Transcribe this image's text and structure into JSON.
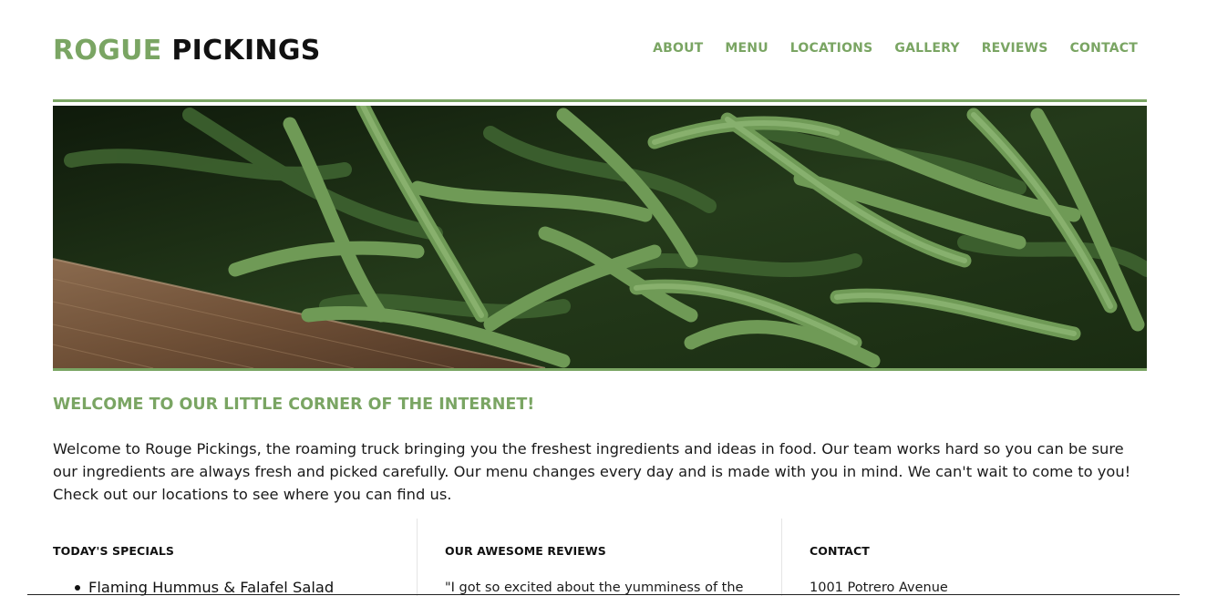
{
  "brand": {
    "accent_word": "ROGUE",
    "main_word": "PICKINGS"
  },
  "nav": {
    "items": [
      {
        "label": "ABOUT"
      },
      {
        "label": "MENU"
      },
      {
        "label": "LOCATIONS"
      },
      {
        "label": "GALLERY"
      },
      {
        "label": "REVIEWS"
      },
      {
        "label": "CONTACT"
      }
    ]
  },
  "welcome": {
    "title": "WELCOME TO OUR LITTLE CORNER OF THE INTERNET!",
    "body": "Welcome to Rouge Pickings, the roaming truck bringing you the freshest ingredients and ideas in food. Our team works hard so you can be sure our ingredients are always fresh and picked carefully. Our menu changes every day and is made with you in mind. We can't wait to come to you! Check out our locations to see where you can find us."
  },
  "specials": {
    "heading": "TODAY'S SPECIALS",
    "items": [
      "Flaming Hummus & Falafel Salad"
    ]
  },
  "reviews": {
    "heading": "OUR AWESOME REVIEWS",
    "snippet": "\"I got so excited about the yumminess of the"
  },
  "contact": {
    "heading": "CONTACT",
    "address": "1001 Potrero Avenue"
  },
  "colors": {
    "accent": "#7aa563",
    "text": "#111111"
  }
}
